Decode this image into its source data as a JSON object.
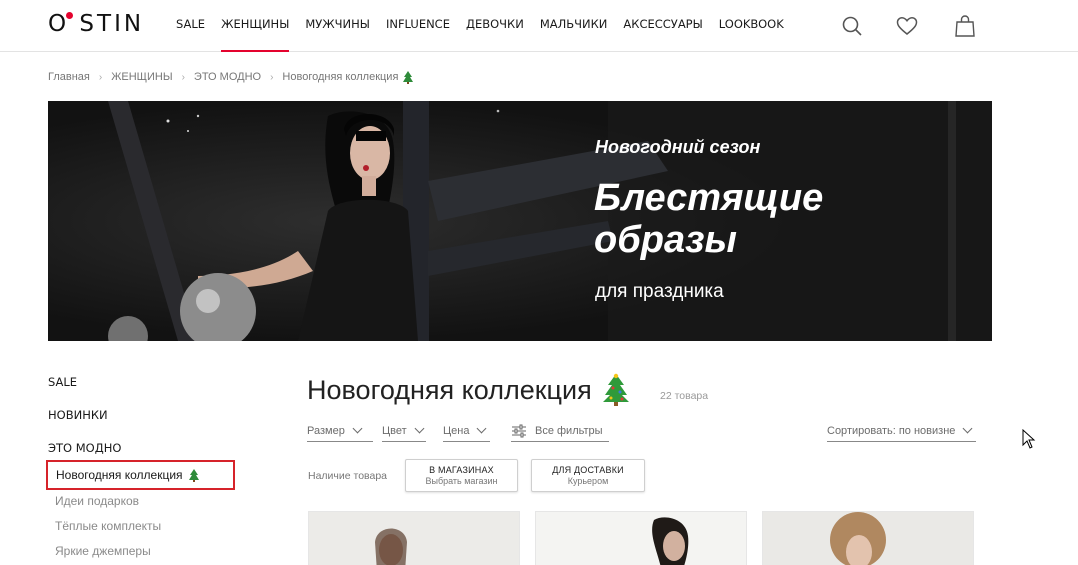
{
  "header": {
    "logo": "O STIN",
    "nav": [
      {
        "label": "SALE",
        "active": false
      },
      {
        "label": "ЖЕНЩИНЫ",
        "active": true
      },
      {
        "label": "МУЖЧИНЫ",
        "active": false
      },
      {
        "label": "INFLUENCE",
        "active": false
      },
      {
        "label": "ДЕВОЧКИ",
        "active": false
      },
      {
        "label": "МАЛЬЧИКИ",
        "active": false
      },
      {
        "label": "АКСЕССУАРЫ",
        "active": false
      },
      {
        "label": "LOOKBOOK",
        "active": false
      }
    ],
    "icons": [
      "search-icon",
      "heart-icon",
      "shopping-bag-icon"
    ],
    "accent": "#e4032e"
  },
  "breadcrumb": {
    "items": [
      "Главная",
      "ЖЕНЩИНЫ",
      "ЭТО МОДНО",
      "Новогодняя коллекция"
    ]
  },
  "banner": {
    "subtitle": "Новогодний сезон",
    "title_line1": "Блестящие",
    "title_line2": "образы",
    "caption": "для праздника"
  },
  "sidebar": {
    "links": [
      "SALE",
      "НОВИНКИ",
      "ЭТО МОДНО"
    ],
    "active_sub": "Новогодняя коллекция",
    "subs": [
      "Идеи подарков",
      "Тёплые комплекты",
      "Яркие джемперы"
    ],
    "highlight_color": "#d6232a"
  },
  "main": {
    "title": "Новогодняя коллекция",
    "count": "22 товара",
    "filters": {
      "size": "Размер",
      "color": "Цвет",
      "price": "Цена",
      "all": "Все фильтры",
      "sort": "Сортировать: по новизне"
    },
    "availability": {
      "label": "Наличие товара",
      "store_title": "В МАГАЗИНАХ",
      "store_sub": "Выбрать магазин",
      "delivery_title": "ДЛЯ ДОСТАВКИ",
      "delivery_sub": "Курьером"
    }
  }
}
